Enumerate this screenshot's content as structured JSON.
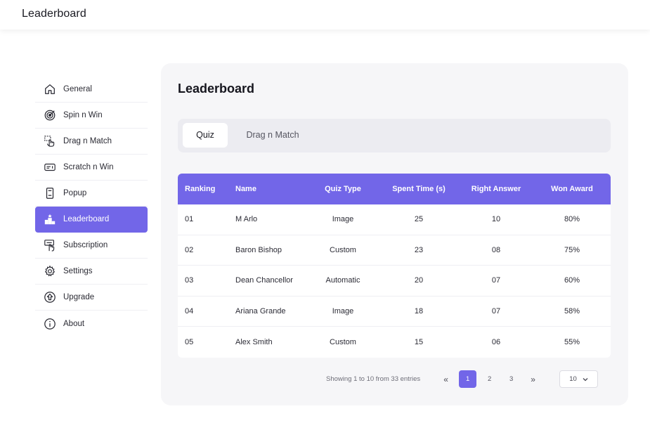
{
  "header": {
    "title": "Leaderboard"
  },
  "sidebar": {
    "items": [
      {
        "label": "General",
        "icon": "home-icon"
      },
      {
        "label": "Spin n Win",
        "icon": "target-icon"
      },
      {
        "label": "Drag n Match",
        "icon": "drag-hand-icon"
      },
      {
        "label": "Scratch n Win",
        "icon": "ticket-icon"
      },
      {
        "label": "Popup",
        "icon": "phone-icon"
      },
      {
        "label": "Leaderboard",
        "icon": "podium-icon",
        "active": true
      },
      {
        "label": "Subscription",
        "icon": "click-icon"
      },
      {
        "label": "Settings",
        "icon": "gear-icon"
      },
      {
        "label": "Upgrade",
        "icon": "upgrade-icon"
      },
      {
        "label": "About",
        "icon": "info-icon"
      }
    ]
  },
  "main": {
    "title": "Leaderboard",
    "tabs": [
      {
        "label": "Quiz",
        "active": true
      },
      {
        "label": "Drag n Match"
      }
    ],
    "table": {
      "columns": [
        "Ranking",
        "Name",
        "Quiz Type",
        "Spent Time (s)",
        "Right Answer",
        "Won Award"
      ],
      "rows": [
        [
          "01",
          "M Arlo",
          "Image",
          "25",
          "10",
          "80%"
        ],
        [
          "02",
          "Baron Bishop",
          "Custom",
          "23",
          "08",
          "75%"
        ],
        [
          "03",
          "Dean Chancellor",
          "Automatic",
          "20",
          "07",
          "60%"
        ],
        [
          "04",
          "Ariana Grande",
          "Image",
          "18",
          "07",
          "58%"
        ],
        [
          "05",
          "Alex Smith",
          "Custom",
          "15",
          "06",
          "55%"
        ]
      ]
    },
    "pagination": {
      "info": "Showing 1 to 10 from 33 entries",
      "first": "«",
      "pages": [
        "1",
        "2",
        "3"
      ],
      "current": "1",
      "last": "»",
      "per_page": "10"
    }
  },
  "colors": {
    "accent": "#7266e8",
    "panel": "#f6f6f8"
  }
}
